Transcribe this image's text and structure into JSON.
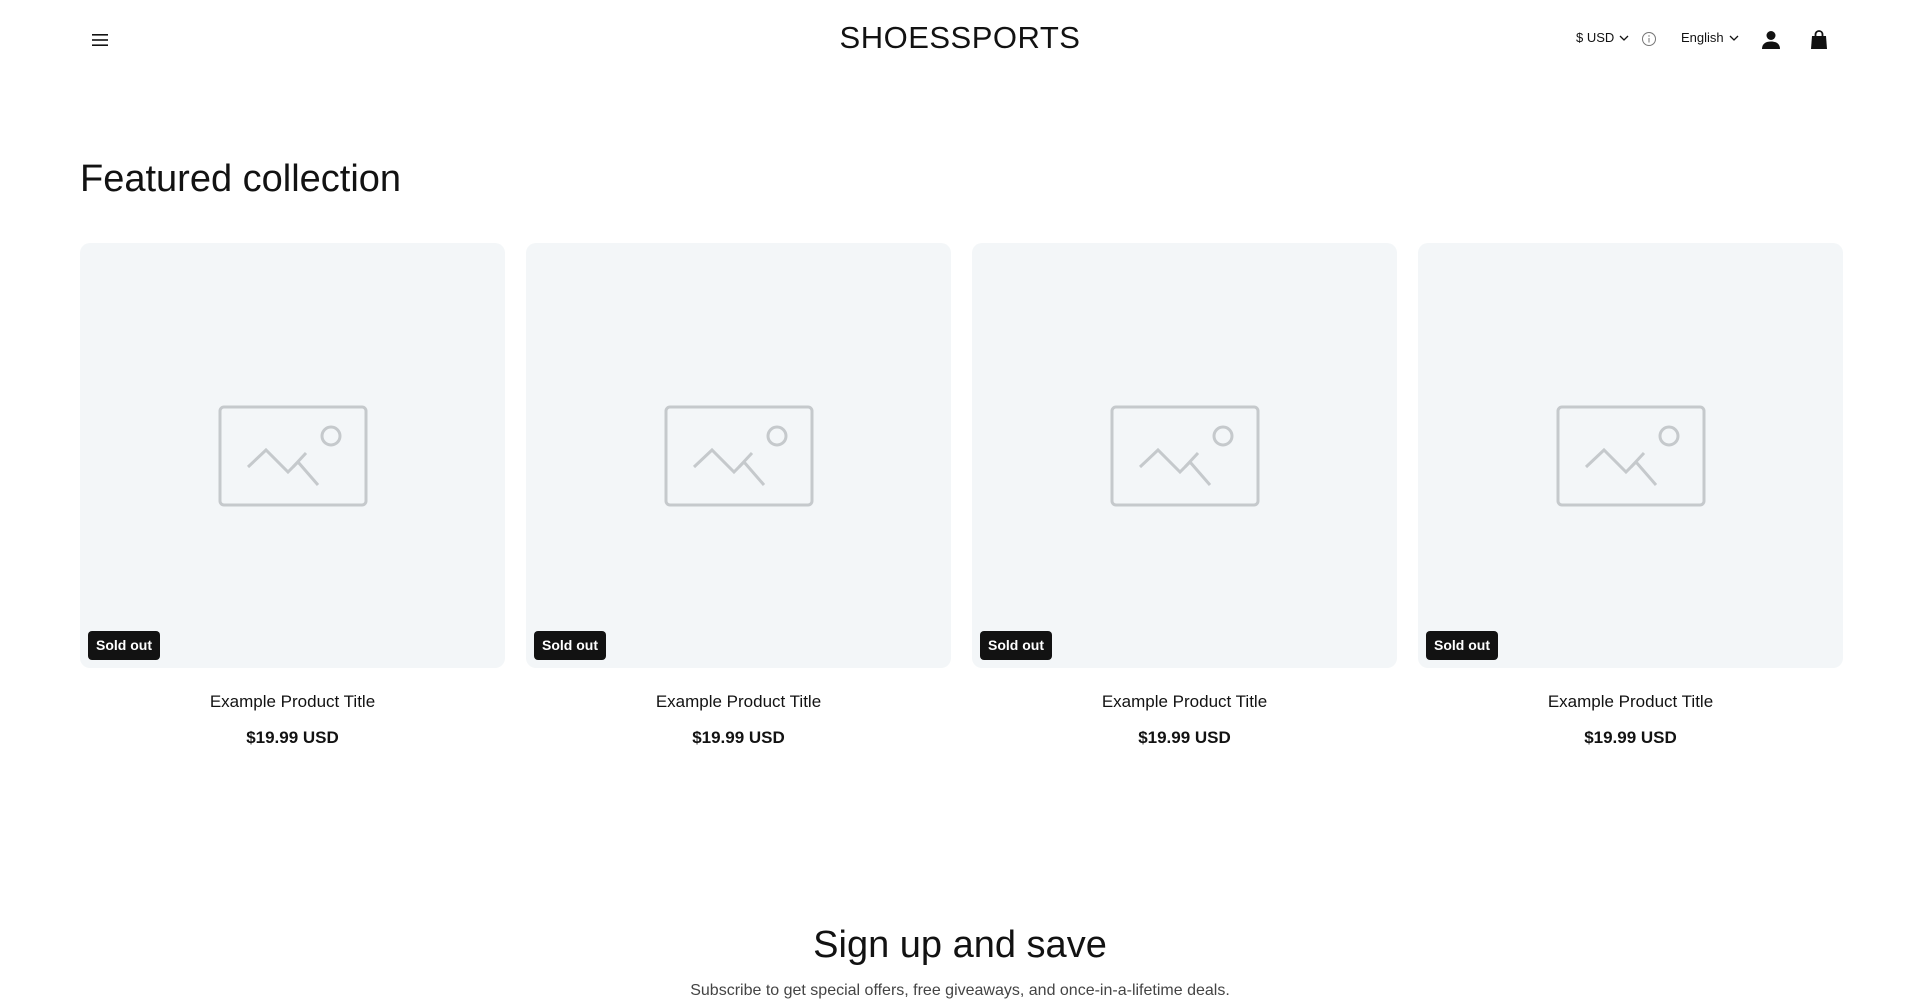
{
  "header": {
    "menu_icon": "hamburger-icon",
    "logo": "SHOESSPORTS",
    "currency": "$ USD",
    "language": "English",
    "info_icon": "info-icon",
    "account_icon": "account-icon",
    "cart_icon": "shopping-bag-icon"
  },
  "featured": {
    "title": "Featured collection",
    "products": [
      {
        "title": "Example Product Title",
        "price": "$19.99 USD",
        "badge": "Sold out"
      },
      {
        "title": "Example Product Title",
        "price": "$19.99 USD",
        "badge": "Sold out"
      },
      {
        "title": "Example Product Title",
        "price": "$19.99 USD",
        "badge": "Sold out"
      },
      {
        "title": "Example Product Title",
        "price": "$19.99 USD",
        "badge": "Sold out"
      }
    ]
  },
  "newsletter": {
    "title": "Sign up and save",
    "text": "Subscribe to get special offers, free giveaways, and once-in-a-lifetime deals."
  },
  "colors": {
    "text": "#121212",
    "card_bg": "#f3f6f8",
    "badge_bg": "#121212",
    "placeholder_stroke": "#c5c9cc"
  }
}
